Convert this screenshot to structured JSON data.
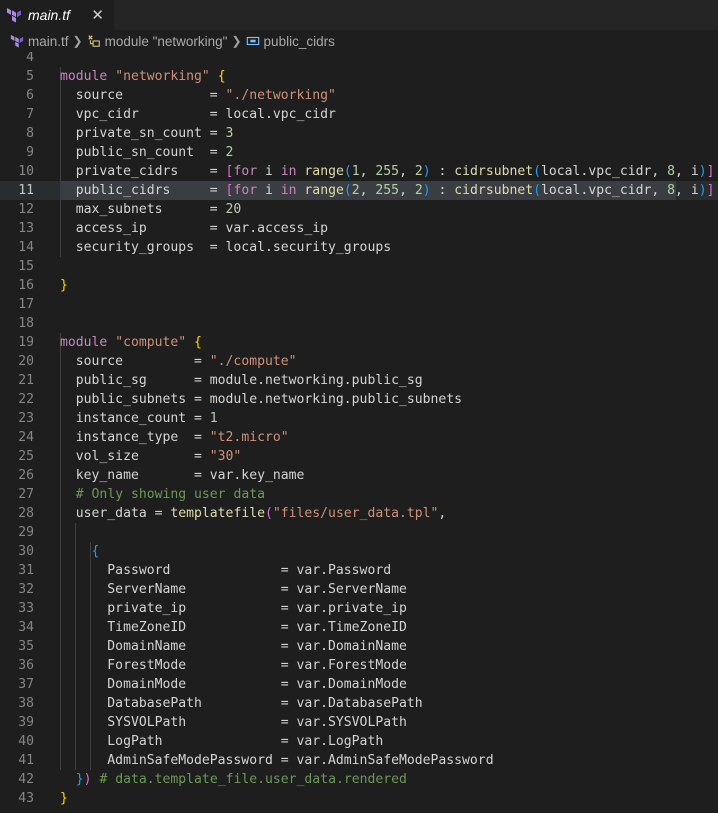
{
  "tab": {
    "icon": "terraform-icon",
    "label": "main.tf",
    "close": "✕"
  },
  "breadcrumb": {
    "file": "main.tf",
    "module": "module \"networking\"",
    "attr": "public_cidrs"
  },
  "editor": {
    "active_line": 11,
    "lines": [
      {
        "n": "4",
        "tokens": []
      },
      {
        "n": "5",
        "tokens": [
          {
            "c": "kw",
            "t": "module "
          },
          {
            "c": "str",
            "t": "\"networking\""
          },
          {
            "c": "txt",
            "t": " "
          },
          {
            "c": "br1",
            "t": "{"
          }
        ]
      },
      {
        "n": "6",
        "tokens": [
          {
            "c": "txt",
            "t": "  source           = "
          },
          {
            "c": "str",
            "t": "\"./networking\""
          }
        ]
      },
      {
        "n": "7",
        "tokens": [
          {
            "c": "txt",
            "t": "  vpc_cidr         = local.vpc_cidr"
          }
        ]
      },
      {
        "n": "8",
        "tokens": [
          {
            "c": "txt",
            "t": "  private_sn_count = "
          },
          {
            "c": "num",
            "t": "3"
          }
        ]
      },
      {
        "n": "9",
        "tokens": [
          {
            "c": "txt",
            "t": "  public_sn_count  = "
          },
          {
            "c": "num",
            "t": "2"
          }
        ]
      },
      {
        "n": "10",
        "tokens": [
          {
            "c": "txt",
            "t": "  private_cidrs    = "
          },
          {
            "c": "br2",
            "t": "["
          },
          {
            "c": "kw",
            "t": "for"
          },
          {
            "c": "txt",
            "t": " i "
          },
          {
            "c": "kw",
            "t": "in"
          },
          {
            "c": "txt",
            "t": " "
          },
          {
            "c": "fn",
            "t": "range"
          },
          {
            "c": "br3",
            "t": "("
          },
          {
            "c": "num",
            "t": "1"
          },
          {
            "c": "txt",
            "t": ", "
          },
          {
            "c": "num",
            "t": "255"
          },
          {
            "c": "txt",
            "t": ", "
          },
          {
            "c": "num",
            "t": "2"
          },
          {
            "c": "br3",
            "t": ")"
          },
          {
            "c": "txt",
            "t": " : "
          },
          {
            "c": "fn",
            "t": "cidrsubnet"
          },
          {
            "c": "br3",
            "t": "("
          },
          {
            "c": "txt",
            "t": "local.vpc_cidr, "
          },
          {
            "c": "num",
            "t": "8"
          },
          {
            "c": "txt",
            "t": ", i"
          },
          {
            "c": "br3",
            "t": ")"
          },
          {
            "c": "br2",
            "t": "]"
          }
        ]
      },
      {
        "n": "11",
        "tokens": [
          {
            "c": "txt",
            "t": "  public_cidrs     = "
          },
          {
            "c": "br2",
            "t": "["
          },
          {
            "c": "kw",
            "t": "for"
          },
          {
            "c": "txt",
            "t": " i "
          },
          {
            "c": "kw",
            "t": "in"
          },
          {
            "c": "txt",
            "t": " "
          },
          {
            "c": "fn",
            "t": "range"
          },
          {
            "c": "br3",
            "t": "("
          },
          {
            "c": "num",
            "t": "2"
          },
          {
            "c": "txt",
            "t": ", "
          },
          {
            "c": "num",
            "t": "255"
          },
          {
            "c": "txt",
            "t": ", "
          },
          {
            "c": "num",
            "t": "2"
          },
          {
            "c": "br3",
            "t": ")"
          },
          {
            "c": "txt",
            "t": " : "
          },
          {
            "c": "fn",
            "t": "cidrsubnet"
          },
          {
            "c": "br3",
            "t": "("
          },
          {
            "c": "txt",
            "t": "local.vpc_cidr, "
          },
          {
            "c": "num",
            "t": "8"
          },
          {
            "c": "txt",
            "t": ", i"
          },
          {
            "c": "br3",
            "t": ")"
          },
          {
            "c": "br2",
            "t": "]"
          }
        ]
      },
      {
        "n": "12",
        "tokens": [
          {
            "c": "txt",
            "t": "  max_subnets      = "
          },
          {
            "c": "num",
            "t": "20"
          }
        ]
      },
      {
        "n": "13",
        "tokens": [
          {
            "c": "txt",
            "t": "  access_ip        = var.access_ip"
          }
        ]
      },
      {
        "n": "14",
        "tokens": [
          {
            "c": "txt",
            "t": "  security_groups  = local.security_groups"
          }
        ]
      },
      {
        "n": "15",
        "tokens": []
      },
      {
        "n": "16",
        "tokens": [
          {
            "c": "br1",
            "t": "}"
          }
        ]
      },
      {
        "n": "17",
        "tokens": []
      },
      {
        "n": "18",
        "tokens": []
      },
      {
        "n": "19",
        "tokens": [
          {
            "c": "kw",
            "t": "module "
          },
          {
            "c": "str",
            "t": "\"compute\""
          },
          {
            "c": "txt",
            "t": " "
          },
          {
            "c": "br1",
            "t": "{"
          }
        ]
      },
      {
        "n": "20",
        "tokens": [
          {
            "c": "txt",
            "t": "  source         = "
          },
          {
            "c": "str",
            "t": "\"./compute\""
          }
        ]
      },
      {
        "n": "21",
        "tokens": [
          {
            "c": "txt",
            "t": "  public_sg      = module.networking.public_sg"
          }
        ]
      },
      {
        "n": "22",
        "tokens": [
          {
            "c": "txt",
            "t": "  public_subnets = module.networking.public_subnets"
          }
        ]
      },
      {
        "n": "23",
        "tokens": [
          {
            "c": "txt",
            "t": "  instance_count = "
          },
          {
            "c": "num",
            "t": "1"
          }
        ]
      },
      {
        "n": "24",
        "tokens": [
          {
            "c": "txt",
            "t": "  instance_type  = "
          },
          {
            "c": "str",
            "t": "\"t2.micro\""
          }
        ]
      },
      {
        "n": "25",
        "tokens": [
          {
            "c": "txt",
            "t": "  vol_size       = "
          },
          {
            "c": "str",
            "t": "\"30\""
          }
        ]
      },
      {
        "n": "26",
        "tokens": [
          {
            "c": "txt",
            "t": "  key_name       = var.key_name"
          }
        ]
      },
      {
        "n": "27",
        "tokens": [
          {
            "c": "txt",
            "t": "  "
          },
          {
            "c": "cmt",
            "t": "# Only showing user data"
          }
        ]
      },
      {
        "n": "28",
        "tokens": [
          {
            "c": "txt",
            "t": "  user_data = "
          },
          {
            "c": "fn",
            "t": "templatefile"
          },
          {
            "c": "br2",
            "t": "("
          },
          {
            "c": "str",
            "t": "\"files/user_data.tpl\""
          },
          {
            "c": "txt",
            "t": ","
          }
        ]
      },
      {
        "n": "29",
        "tokens": []
      },
      {
        "n": "30",
        "tokens": [
          {
            "c": "txt",
            "t": "    "
          },
          {
            "c": "br3",
            "t": "{"
          }
        ]
      },
      {
        "n": "31",
        "tokens": [
          {
            "c": "txt",
            "t": "      Password              = var.Password"
          }
        ]
      },
      {
        "n": "32",
        "tokens": [
          {
            "c": "txt",
            "t": "      ServerName            = var.ServerName"
          }
        ]
      },
      {
        "n": "33",
        "tokens": [
          {
            "c": "txt",
            "t": "      private_ip            = var.private_ip"
          }
        ]
      },
      {
        "n": "34",
        "tokens": [
          {
            "c": "txt",
            "t": "      TimeZoneID            = var.TimeZoneID"
          }
        ]
      },
      {
        "n": "35",
        "tokens": [
          {
            "c": "txt",
            "t": "      DomainName            = var.DomainName"
          }
        ]
      },
      {
        "n": "36",
        "tokens": [
          {
            "c": "txt",
            "t": "      ForestMode            = var.ForestMode"
          }
        ]
      },
      {
        "n": "37",
        "tokens": [
          {
            "c": "txt",
            "t": "      DomainMode            = var.DomainMode"
          }
        ]
      },
      {
        "n": "38",
        "tokens": [
          {
            "c": "txt",
            "t": "      DatabasePath          = var.DatabasePath"
          }
        ]
      },
      {
        "n": "39",
        "tokens": [
          {
            "c": "txt",
            "t": "      SYSVOLPath            = var.SYSVOLPath"
          }
        ]
      },
      {
        "n": "40",
        "tokens": [
          {
            "c": "txt",
            "t": "      LogPath               = var.LogPath"
          }
        ]
      },
      {
        "n": "41",
        "tokens": [
          {
            "c": "txt",
            "t": "      AdminSafeModePassword = var.AdminSafeModePassword"
          }
        ]
      },
      {
        "n": "42",
        "tokens": [
          {
            "c": "txt",
            "t": "  "
          },
          {
            "c": "br3",
            "t": "}"
          },
          {
            "c": "br2",
            "t": ")"
          },
          {
            "c": "txt",
            "t": " "
          },
          {
            "c": "cmt",
            "t": "# data.template_file.user_data.rendered"
          }
        ]
      },
      {
        "n": "43",
        "tokens": [
          {
            "c": "br1",
            "t": "}"
          }
        ]
      }
    ]
  }
}
